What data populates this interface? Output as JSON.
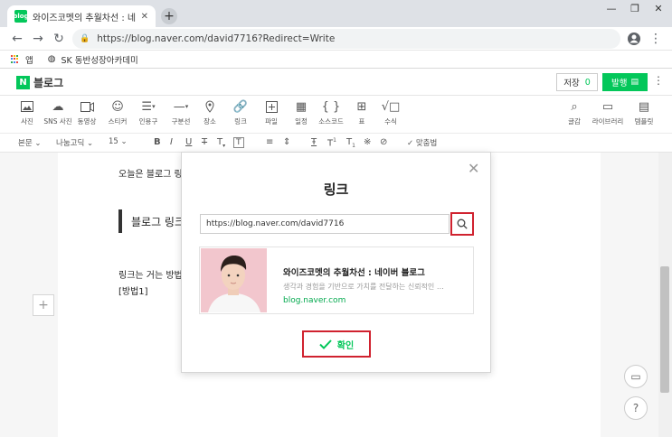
{
  "browser": {
    "tab_title": "와이즈코멧의 추월차선 : 네이버",
    "url": "https://blog.naver.com/david7716?Redirect=Write",
    "bookmarks": [
      {
        "label": "앱"
      },
      {
        "label": "SK 동반성장아카데미"
      }
    ]
  },
  "header": {
    "logo_text": "블로그",
    "save_label": "저장",
    "save_count": "0",
    "publish_label": "발행"
  },
  "toolbar": {
    "items": [
      {
        "label": "사진",
        "icon": "photo-icon"
      },
      {
        "label": "SNS 사진",
        "icon": "cloud-icon"
      },
      {
        "label": "동영상",
        "icon": "video-icon"
      },
      {
        "label": "스티커",
        "icon": "sticker-icon"
      },
      {
        "label": "인용구",
        "icon": "quote-icon"
      },
      {
        "label": "구분선",
        "icon": "divider-icon"
      },
      {
        "label": "장소",
        "icon": "place-icon"
      },
      {
        "label": "링크",
        "icon": "link-icon"
      },
      {
        "label": "파일",
        "icon": "file-icon"
      },
      {
        "label": "일정",
        "icon": "calendar-icon"
      },
      {
        "label": "소스코드",
        "icon": "code-icon"
      },
      {
        "label": "표",
        "icon": "table-icon"
      },
      {
        "label": "수식",
        "icon": "formula-icon"
      }
    ],
    "right_items": [
      {
        "label": "글감",
        "icon": "material-icon"
      },
      {
        "label": "라이브러리",
        "icon": "library-icon"
      },
      {
        "label": "템플릿",
        "icon": "template-icon"
      }
    ]
  },
  "format": {
    "style": "본문",
    "font": "나눔고딕",
    "size": "15",
    "spellcheck": "맞춤법"
  },
  "editor": {
    "line1": "오늘은 블로그 링",
    "quote": "블로그 링크",
    "line2": "링크는 거는 방법",
    "line3": "[방법1]"
  },
  "dialog": {
    "title": "링크",
    "input_value": "https://blog.naver.com/david7716",
    "preview_title": "와이즈코멧의 추월차선 : 네이버 블로그",
    "preview_desc": "생각과 경험을 기반으로 가치를 전달하는 신뢰적인 …",
    "preview_url": "blog.naver.com",
    "confirm_label": "확인"
  },
  "colors": {
    "naver_green": "#03c75a",
    "highlight_red": "#d0222f"
  }
}
